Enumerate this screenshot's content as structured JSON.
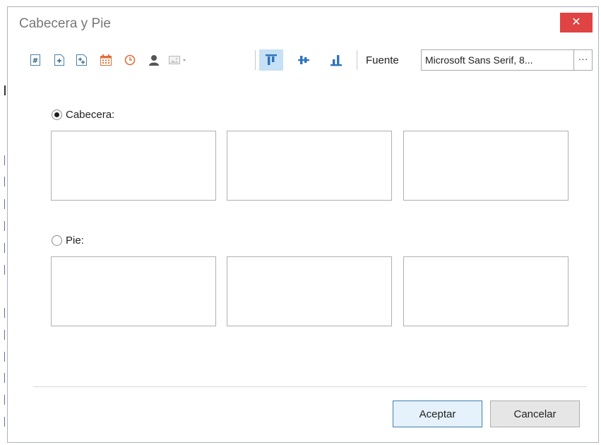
{
  "dialog": {
    "title": "Cabecera y Pie",
    "close_symbol": "✕"
  },
  "toolbar": {
    "icons": [
      {
        "name": "page-number-icon",
        "symbol": "#",
        "color": "#4d7fa8"
      },
      {
        "name": "page-count-icon",
        "symbol": "+",
        "color": "#4d7fa8"
      },
      {
        "name": "page-of-pages-icon",
        "symbol": "+",
        "color": "#4d7fa8"
      },
      {
        "name": "date-icon",
        "symbol": "calendar",
        "color": "#e0703a"
      },
      {
        "name": "time-icon",
        "symbol": "clock",
        "color": "#e0703a"
      },
      {
        "name": "user-icon",
        "symbol": "user",
        "color": "#555555"
      },
      {
        "name": "image-icon",
        "symbol": "image",
        "color": "#b0b0b0"
      },
      {
        "name": "align-top-icon",
        "symbol": "align-top",
        "color": "#2e73b8"
      },
      {
        "name": "align-middle-icon",
        "symbol": "align-middle",
        "color": "#2e73b8"
      },
      {
        "name": "align-bottom-icon",
        "symbol": "align-bottom",
        "color": "#2e73b8"
      }
    ],
    "font_label": "Fuente",
    "font_value": "Microsoft Sans Serif, 8...",
    "font_button": "···"
  },
  "header": {
    "label": "Cabecera:",
    "selected": true
  },
  "footer": {
    "label": "Pie:",
    "selected": false
  },
  "buttons": {
    "accept": "Aceptar",
    "cancel": "Cancelar"
  }
}
